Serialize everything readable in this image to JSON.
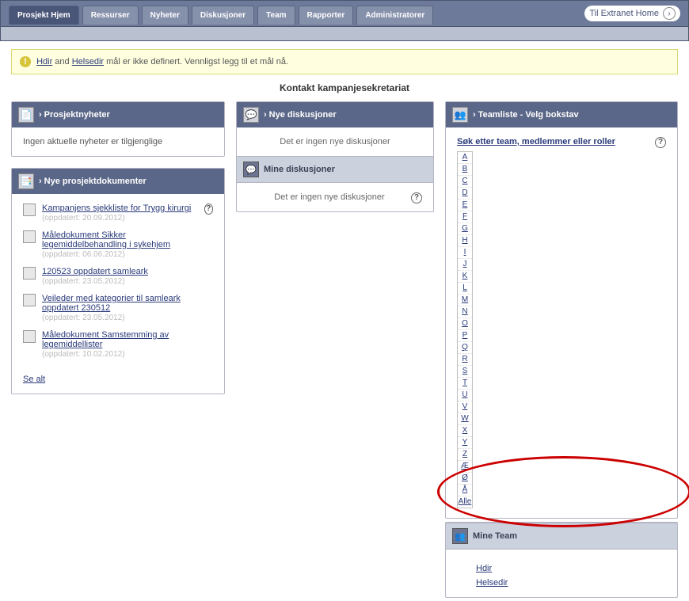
{
  "tabs": {
    "items": [
      {
        "label": "Prosjekt Hjem",
        "active": true
      },
      {
        "label": "Ressurser",
        "active": false
      },
      {
        "label": "Nyheter",
        "active": false
      },
      {
        "label": "Diskusjoner",
        "active": false
      },
      {
        "label": "Team",
        "active": false
      },
      {
        "label": "Rapporter",
        "active": false
      },
      {
        "label": "Administratorer",
        "active": false
      }
    ],
    "home_link": "Til Extranet Home"
  },
  "warning": {
    "link1": "Hdir",
    "mid": " and ",
    "link2": "Helsedir",
    "text": " mål er ikke definert. Vennligst legg til et mål nå."
  },
  "section_title": "Kontakt kampanjesekretariat",
  "news": {
    "title": "Prosjektnyheter",
    "body": "Ingen aktuelle nyheter er tilgjenglige"
  },
  "docs": {
    "title": "Nye prosjektdokumenter",
    "items": [
      {
        "label": "Kampanjens sjekkliste for Trygg kirurgi",
        "date": "(oppdatert: 20.09.2012)"
      },
      {
        "label": "Måledokument Sikker legemiddelbehandling i sykehjem",
        "date": "(oppdatert: 06.06.2012)"
      },
      {
        "label": "120523 oppdatert samleark",
        "date": "(oppdatert: 23.05.2012)"
      },
      {
        "label": "Veileder med kategorier til samleark oppdatert 230512",
        "date": "(oppdatert: 23.05.2012)"
      },
      {
        "label": "Måledokument Samstemming av legemiddellister",
        "date": "(oppdatert: 10.02.2012)"
      }
    ],
    "see_all": "Se alt"
  },
  "disc": {
    "title": "Nye diskusjoner",
    "none1": "Det er ingen nye diskusjoner",
    "mine_title": "Mine diskusjoner",
    "none2": "Det er ingen nye diskusjoner"
  },
  "teams": {
    "title": "Teamliste - Velg bokstav",
    "search": "Søk etter team, medlemmer eller roller",
    "alpha": [
      "A",
      "B",
      "C",
      "D",
      "E",
      "F",
      "G",
      "H",
      "I",
      "J",
      "K",
      "L",
      "M",
      "N",
      "O",
      "P",
      "Q",
      "R",
      "S",
      "T",
      "U",
      "V",
      "W",
      "X",
      "Y",
      "Z",
      "Æ",
      "Ø",
      "Å",
      "Alle"
    ],
    "mine_title": "Mine Team",
    "mine": [
      "Hdir",
      "Helsedir"
    ]
  }
}
